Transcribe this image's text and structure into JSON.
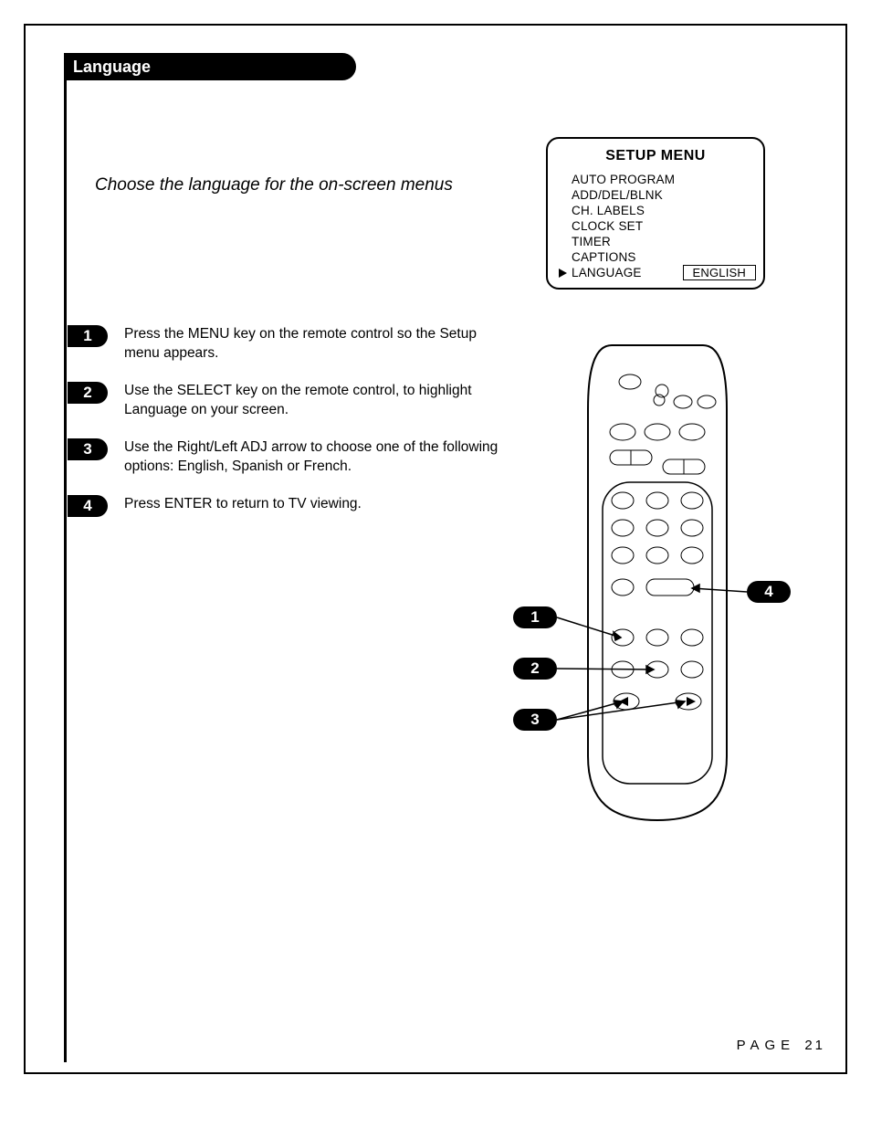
{
  "section_tab": "Language",
  "intro": "Choose the language for the on-screen menus",
  "setup_menu": {
    "title": "SETUP MENU",
    "items": [
      "AUTO PROGRAM",
      "ADD/DEL/BLNK",
      "CH. LABELS",
      "CLOCK SET",
      "TIMER",
      "CAPTIONS",
      "LANGUAGE"
    ],
    "selected_value": "ENGLISH"
  },
  "steps": [
    {
      "num": "1",
      "text": "Press the MENU key on the remote control so the Setup menu appears."
    },
    {
      "num": "2",
      "text": "Use the SELECT key on the remote control, to highlight Language on your screen."
    },
    {
      "num": "3",
      "text": "Use the Right/Left ADJ arrow to choose one of the following options: English, Spanish or French."
    },
    {
      "num": "4",
      "text": "Press ENTER to return to TV viewing."
    }
  ],
  "callouts": {
    "c1": "1",
    "c2": "2",
    "c3": "3",
    "c4": "4"
  },
  "footer": {
    "label": "PAGE",
    "num": "21"
  }
}
